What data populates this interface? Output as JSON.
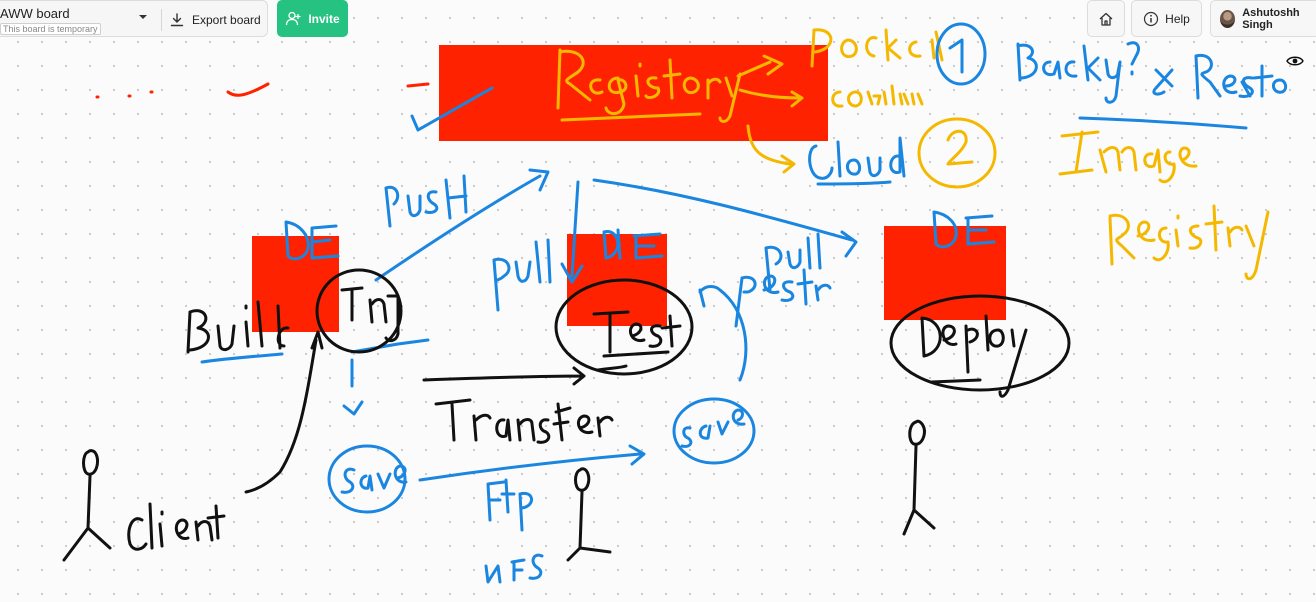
{
  "toolbar": {
    "board_title": "AWW board",
    "board_subtitle": "This board is temporary",
    "export_label": "Export board",
    "invite_label": "Invite",
    "help_label": "Help",
    "user_name": "Ashutoshh Singh"
  },
  "colors": {
    "accent": "#26c281",
    "block_red": "#ff2200",
    "ink_blue": "#1a86e0",
    "ink_yellow": "#f5b800",
    "ink_black": "#111111"
  },
  "icons": [
    "chevron-down-icon",
    "download-icon",
    "add-user-icon",
    "home-icon",
    "info-icon",
    "eye-icon"
  ]
}
